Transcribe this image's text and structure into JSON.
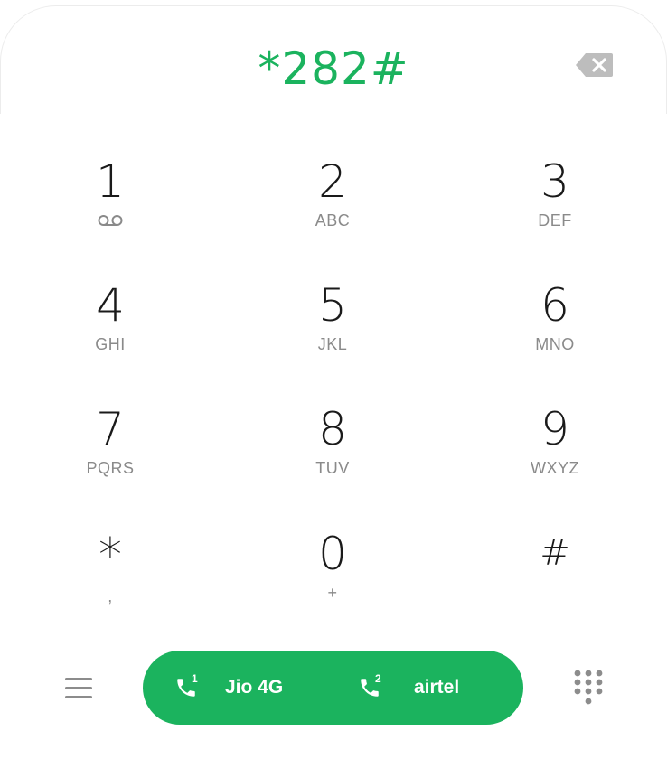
{
  "colors": {
    "accent": "#1bb35e",
    "digit": "#1a1a1a",
    "letters": "#8a8a8a",
    "icon_gray": "#8c8c8c",
    "backspace_gray": "#bdbdbd"
  },
  "display": {
    "number": "*282#"
  },
  "icons": {
    "backspace": "backspace-icon",
    "voicemail": "voicemail-icon",
    "menu": "menu-icon",
    "phone": "phone-icon",
    "dialpad": "dialpad-icon"
  },
  "keypad": {
    "keys": [
      {
        "digit": "1",
        "letters": "",
        "icon": "voicemail-icon"
      },
      {
        "digit": "2",
        "letters": "ABC"
      },
      {
        "digit": "3",
        "letters": "DEF"
      },
      {
        "digit": "4",
        "letters": "GHI"
      },
      {
        "digit": "5",
        "letters": "JKL"
      },
      {
        "digit": "6",
        "letters": "MNO"
      },
      {
        "digit": "7",
        "letters": "PQRS"
      },
      {
        "digit": "8",
        "letters": "TUV"
      },
      {
        "digit": "9",
        "letters": "WXYZ"
      },
      {
        "digit": "*",
        "letters": ","
      },
      {
        "digit": "0",
        "letters": "+"
      },
      {
        "digit": "#",
        "letters": ""
      }
    ]
  },
  "call": {
    "sim1": {
      "slot": "1",
      "carrier": "Jio 4G"
    },
    "sim2": {
      "slot": "2",
      "carrier": "airtel"
    }
  }
}
